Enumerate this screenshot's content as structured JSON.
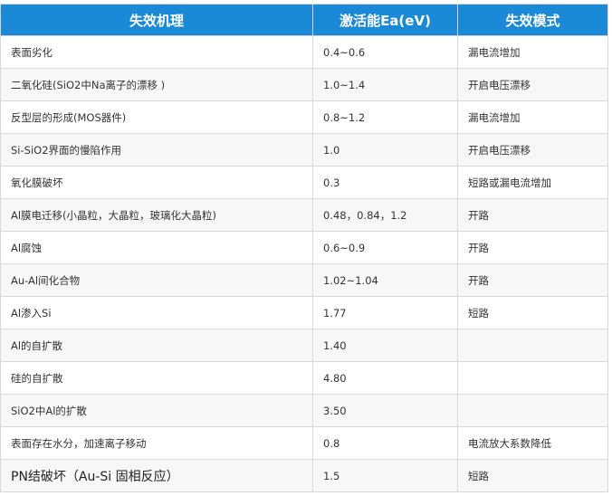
{
  "headers": [
    "失效机理",
    "激活能Ea(eV)",
    "失效模式"
  ],
  "rows": [
    [
      "表面劣化",
      "0.4~0.6",
      "漏电流增加"
    ],
    [
      "二氧化硅(SiO2中Na离子的漂移 )",
      "1.0~1.4",
      "开启电压漂移"
    ],
    [
      "反型层的形成(MOS器件)",
      "0.8~1.2",
      "漏电流增加"
    ],
    [
      "Si-SiO2界面的慢陷作用",
      "1.0",
      "开启电压漂移"
    ],
    [
      "氧化膜破坏",
      "0.3",
      "短路或漏电流增加"
    ],
    [
      "Al膜电迁移(小晶粒，大晶粒，玻璃化大晶粒)",
      "0.48，0.84，1.2",
      "开路"
    ],
    [
      "Al腐蚀",
      "0.6~0.9",
      "开路"
    ],
    [
      "Au-Al间化合物",
      "1.02~1.04",
      "开路"
    ],
    [
      "Al渗入Si",
      "1.77",
      "短路"
    ],
    [
      "Al的自扩散",
      "1.40",
      ""
    ],
    [
      "硅的自扩散",
      "4.80",
      ""
    ],
    [
      "SiO2中Al的扩散",
      "3.50",
      ""
    ],
    [
      "表面存在水分，加速离子移动",
      "0.8",
      "电流放大系数降低"
    ],
    [
      "PN结破坏（Au-Si 固相反应）",
      "1.5",
      "短路"
    ]
  ]
}
